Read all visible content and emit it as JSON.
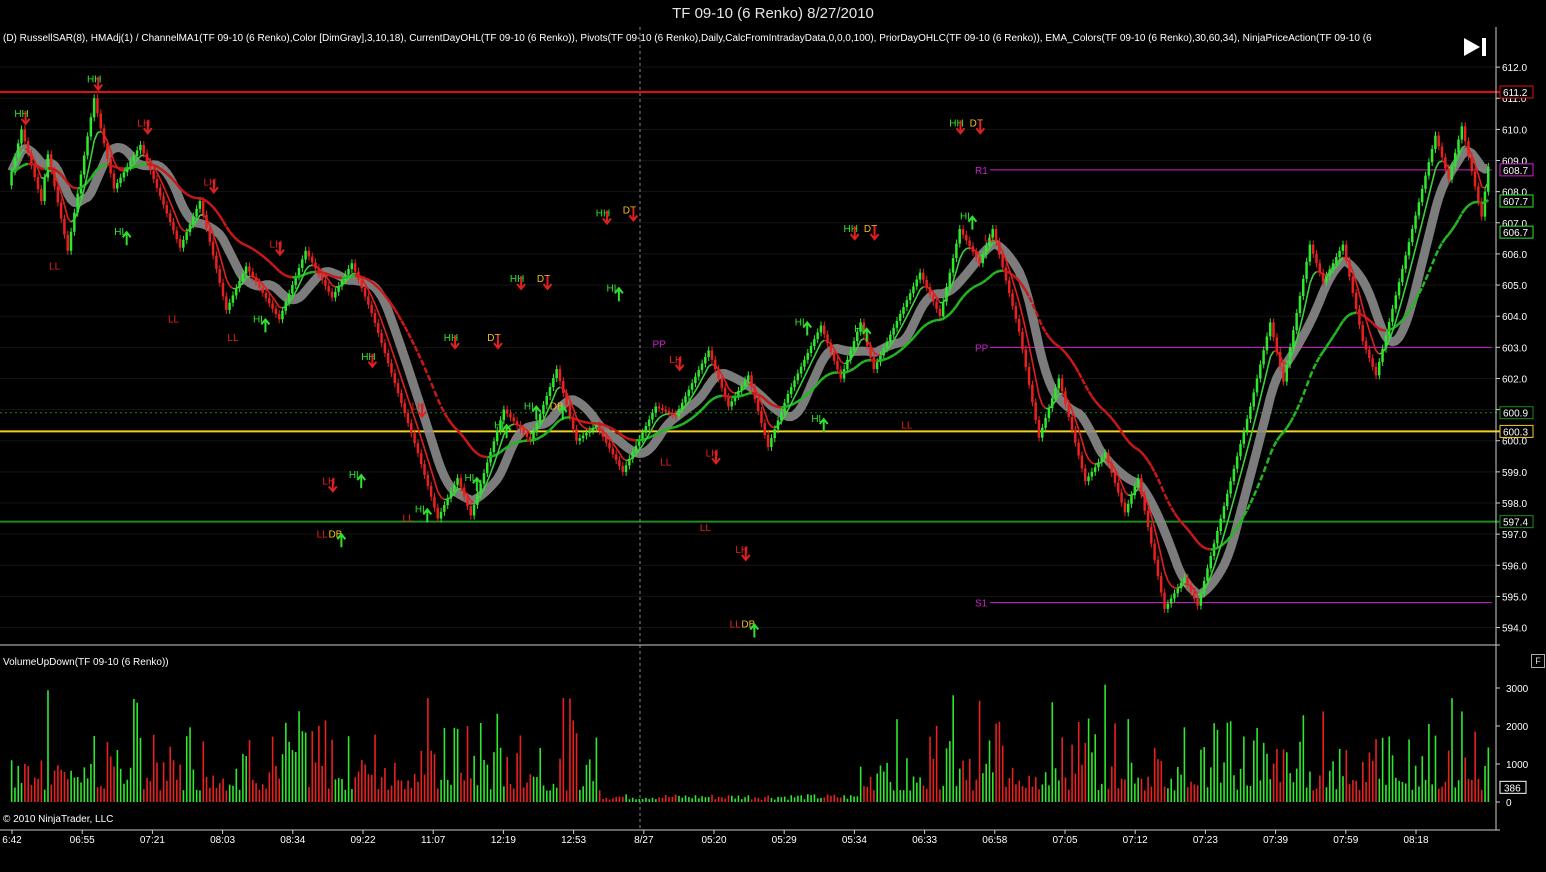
{
  "window": {
    "title": "TF 09-10 (6 Renko)  8/27/2010"
  },
  "indicators_label": "(D) RussellSAR(8),  HMAdj(1) / ChannelMA1(TF 09-10 (6 Renko),Color [DimGray],3,10,18), CurrentDayOHL(TF 09-10 (6 Renko)), Pivots(TF 09-10 (6 Renko),Daily,CalcFromIntradayData,0,0,0,100), PriorDayOHLC(TF 09-10 (6 Renko)), EMA_Colors(TF 09-10 (6 Renko),30,60,34), NinjaPriceAction(TF 09-10 (6",
  "volume_label": "VolumeUpDown(TF 09-10 (6 Renko))",
  "copyright": "© 2010 NinjaTrader, LLC",
  "panel_button": "F",
  "colors": {
    "up": "#2ee82e",
    "down": "#e82020",
    "bg": "#000000",
    "grid": "#333333",
    "red_line": "#e01010",
    "yellow_line": "#f0d020",
    "green_line": "#1c8c1c",
    "pivot": "#d020d0",
    "channel": "#8a8a8a"
  },
  "chart_data": {
    "type": "renko",
    "price_axis": {
      "ticks": [
        "612.0",
        "611.0",
        "610.0",
        "609.0",
        "608.0",
        "607.0",
        "606.0",
        "605.0",
        "604.0",
        "603.0",
        "602.0",
        "601.0",
        "600.0",
        "599.0",
        "598.0",
        "597.0",
        "596.0",
        "595.0",
        "594.0"
      ],
      "range": [
        593.6,
        612.1
      ]
    },
    "price_markers": [
      {
        "label": "611.2",
        "value": 611.2,
        "color": "#e01010"
      },
      {
        "label": "608.7",
        "value": 608.7,
        "color": "#d020d0"
      },
      {
        "label": "607.7",
        "value": 607.7,
        "color": "#2ee82e"
      },
      {
        "label": "606.7",
        "value": 606.7,
        "color": "#2ee82e"
      },
      {
        "label": "600.9",
        "value": 600.9,
        "color": "#1c8c1c"
      },
      {
        "label": "600.3",
        "value": 600.3,
        "color": "#f0d020"
      },
      {
        "label": "597.4",
        "value": 597.4,
        "color": "#1c8c1c"
      }
    ],
    "levels": [
      {
        "name": "prior-high",
        "value": 611.2,
        "color": "#e01010",
        "width": 2
      },
      {
        "name": "prior-close",
        "value": 600.9,
        "color": "#1c8c1c",
        "dashed": true,
        "width": 1
      },
      {
        "name": "prior-open",
        "value": 600.3,
        "color": "#f0d020",
        "width": 2
      },
      {
        "name": "prior-low",
        "value": 597.4,
        "color": "#1c8c1c",
        "width": 2
      }
    ],
    "pivots": [
      {
        "label": "R1",
        "value": 608.7
      },
      {
        "label": "PP",
        "value": 603.0
      },
      {
        "label": "S1",
        "value": 594.8
      }
    ],
    "time_labels": [
      "6:42",
      "06:55",
      "07:21",
      "08:03",
      "08:34",
      "09:22",
      "11:07",
      "12:19",
      "12:53",
      "8/27",
      "05:20",
      "05:29",
      "05:34",
      "06:33",
      "06:58",
      "07:05",
      "07:12",
      "07:23",
      "07:39",
      "07:59",
      "08:18"
    ],
    "session_break_label": "8/27",
    "path": [
      [
        0,
        608.2
      ],
      [
        4,
        610.0
      ],
      [
        10,
        607.7
      ],
      [
        12,
        609.2
      ],
      [
        18,
        606.1
      ],
      [
        26,
        611.0
      ],
      [
        32,
        608.1
      ],
      [
        40,
        609.5
      ],
      [
        52,
        606.2
      ],
      [
        58,
        607.7
      ],
      [
        66,
        604.2
      ],
      [
        72,
        605.6
      ],
      [
        82,
        603.9
      ],
      [
        90,
        606.1
      ],
      [
        98,
        604.6
      ],
      [
        104,
        605.7
      ],
      [
        110,
        604.1
      ],
      [
        124,
        599.6
      ],
      [
        130,
        597.5
      ],
      [
        136,
        598.8
      ],
      [
        140,
        597.6
      ],
      [
        150,
        601.0
      ],
      [
        158,
        600.0
      ],
      [
        166,
        602.3
      ],
      [
        172,
        600.0
      ],
      [
        178,
        600.5
      ],
      [
        186,
        599.0
      ],
      [
        196,
        601.1
      ],
      [
        202,
        600.8
      ],
      [
        212,
        602.9
      ],
      [
        218,
        601.1
      ],
      [
        224,
        602.1
      ],
      [
        230,
        599.8
      ],
      [
        236,
        601.5
      ],
      [
        246,
        603.7
      ],
      [
        252,
        602.0
      ],
      [
        258,
        603.8
      ],
      [
        262,
        602.3
      ],
      [
        276,
        605.4
      ],
      [
        282,
        604.0
      ],
      [
        288,
        606.8
      ],
      [
        294,
        605.7
      ],
      [
        298,
        606.8
      ],
      [
        306,
        603.5
      ],
      [
        312,
        600.1
      ],
      [
        318,
        602.0
      ],
      [
        326,
        598.7
      ],
      [
        332,
        599.6
      ],
      [
        338,
        597.7
      ],
      [
        342,
        598.8
      ],
      [
        350,
        594.6
      ],
      [
        356,
        595.6
      ],
      [
        360,
        594.7
      ],
      [
        376,
        601.1
      ],
      [
        382,
        603.8
      ],
      [
        386,
        601.9
      ],
      [
        394,
        606.3
      ],
      [
        398,
        605.1
      ],
      [
        404,
        606.3
      ],
      [
        410,
        603.2
      ],
      [
        414,
        602.1
      ],
      [
        432,
        609.8
      ],
      [
        436,
        608.4
      ],
      [
        440,
        610.1
      ],
      [
        446,
        607.2
      ],
      [
        448,
        608.8
      ]
    ],
    "labels": [
      {
        "t": "HH",
        "i": 3,
        "p": 610.4,
        "c": "#2ee82e"
      },
      {
        "t": "HH",
        "i": 25,
        "p": 611.5,
        "c": "#2ee82e"
      },
      {
        "t": "LH",
        "i": 40,
        "p": 610.1,
        "c": "#e82020"
      },
      {
        "t": "HL",
        "i": 33,
        "p": 606.6,
        "c": "#2ee82e"
      },
      {
        "t": "LL",
        "i": 13,
        "p": 605.5,
        "c": "#e82020"
      },
      {
        "t": "LH",
        "i": 60,
        "p": 608.2,
        "c": "#e82020"
      },
      {
        "t": "LL",
        "i": 49,
        "p": 603.8,
        "c": "#e82020"
      },
      {
        "t": "LL",
        "i": 67,
        "p": 603.2,
        "c": "#e82020"
      },
      {
        "t": "HL",
        "i": 75,
        "p": 603.8,
        "c": "#2ee82e"
      },
      {
        "t": "LH",
        "i": 80,
        "p": 606.2,
        "c": "#e82020"
      },
      {
        "t": "LH",
        "i": 96,
        "p": 598.6,
        "c": "#e82020"
      },
      {
        "t": "LL",
        "i": 94,
        "p": 596.9,
        "c": "#e82020"
      },
      {
        "t": "DB",
        "i": 98,
        "p": 596.9,
        "c": "#f0c020"
      },
      {
        "t": "HH",
        "i": 108,
        "p": 602.6,
        "c": "#2ee82e"
      },
      {
        "t": "HL",
        "i": 104,
        "p": 598.8,
        "c": "#2ee82e"
      },
      {
        "t": "LL",
        "i": 120,
        "p": 597.4,
        "c": "#e82020"
      },
      {
        "t": "HL",
        "i": 124,
        "p": 597.7,
        "c": "#2ee82e"
      },
      {
        "t": "LH",
        "i": 123,
        "p": 601.0,
        "c": "#e82020"
      },
      {
        "t": "HH",
        "i": 133,
        "p": 603.2,
        "c": "#2ee82e"
      },
      {
        "t": "HL",
        "i": 139,
        "p": 598.7,
        "c": "#2ee82e"
      },
      {
        "t": "HL",
        "i": 148,
        "p": 600.4,
        "c": "#2ee82e"
      },
      {
        "t": "DT",
        "i": 146,
        "p": 603.2,
        "c": "#f0c020"
      },
      {
        "t": "HH",
        "i": 153,
        "p": 605.1,
        "c": "#2ee82e"
      },
      {
        "t": "HL",
        "i": 157,
        "p": 601.0,
        "c": "#2ee82e"
      },
      {
        "t": "DT",
        "i": 161,
        "p": 605.1,
        "c": "#f0c020"
      },
      {
        "t": "DB",
        "i": 165,
        "p": 601.0,
        "c": "#f0c020"
      },
      {
        "t": "HH",
        "i": 179,
        "p": 607.2,
        "c": "#2ee82e"
      },
      {
        "t": "DT",
        "i": 187,
        "p": 607.3,
        "c": "#f0c020"
      },
      {
        "t": "HL",
        "i": 182,
        "p": 604.8,
        "c": "#2ee82e"
      },
      {
        "t": "PP",
        "i": 196,
        "p": 603.0,
        "c": "#d020d0"
      },
      {
        "t": "LH",
        "i": 201,
        "p": 602.5,
        "c": "#e82020"
      },
      {
        "t": "LL",
        "i": 198,
        "p": 599.2,
        "c": "#e82020"
      },
      {
        "t": "LH",
        "i": 212,
        "p": 599.5,
        "c": "#e82020"
      },
      {
        "t": "LL",
        "i": 210,
        "p": 597.1,
        "c": "#e82020"
      },
      {
        "t": "LH",
        "i": 221,
        "p": 596.4,
        "c": "#e82020"
      },
      {
        "t": "LL",
        "i": 219,
        "p": 594.0,
        "c": "#e82020"
      },
      {
        "t": "DB",
        "i": 223,
        "p": 594.0,
        "c": "#f0c020"
      },
      {
        "t": "HL",
        "i": 239,
        "p": 603.7,
        "c": "#2ee82e"
      },
      {
        "t": "HL",
        "i": 244,
        "p": 600.6,
        "c": "#2ee82e"
      },
      {
        "t": "HH",
        "i": 254,
        "p": 606.7,
        "c": "#2ee82e"
      },
      {
        "t": "DT",
        "i": 260,
        "p": 606.7,
        "c": "#f0c020"
      },
      {
        "t": "HL",
        "i": 257,
        "p": 603.5,
        "c": "#2ee82e"
      },
      {
        "t": "LL",
        "i": 271,
        "p": 600.4,
        "c": "#e82020"
      },
      {
        "t": "HH",
        "i": 286,
        "p": 610.1,
        "c": "#2ee82e"
      },
      {
        "t": "DT",
        "i": 292,
        "p": 610.1,
        "c": "#f0c020"
      },
      {
        "t": "HL",
        "i": 289,
        "p": 607.1,
        "c": "#2ee82e"
      },
      {
        "t": "LL",
        "i": 296,
        "p": 606.4,
        "c": "#e82020"
      }
    ],
    "volume": {
      "axis_ticks": [
        "3000",
        "2000",
        "1000",
        "0"
      ],
      "last_value": "386",
      "range": [
        0,
        4000
      ]
    }
  }
}
